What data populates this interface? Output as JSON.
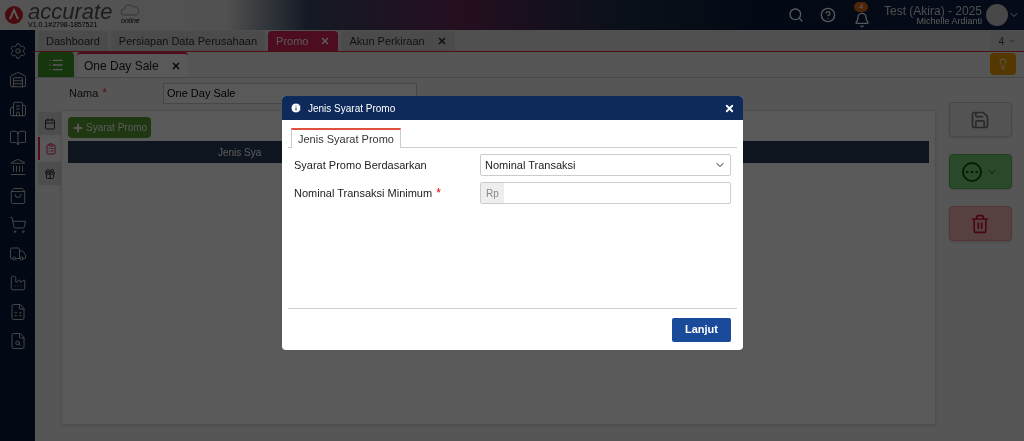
{
  "header": {
    "logo_text": "accurate",
    "logo_sub": "online",
    "version": "V1.0.1#2798-1857521",
    "notification_count": "4",
    "company": "Test (Akira) - 2025",
    "user": "Michelle Ardianti"
  },
  "tabs": [
    {
      "label": "Dashboard",
      "selected": false,
      "closable": false
    },
    {
      "label": "Persiapan Data Perusahaan",
      "selected": false,
      "closable": false
    },
    {
      "label": "Promo",
      "selected": true,
      "closable": true
    },
    {
      "label": "Akun Perkiraan",
      "selected": false,
      "closable": true
    }
  ],
  "tab_overflow": "4",
  "subtabs": [
    {
      "label": "One Day Sale",
      "selected": true
    }
  ],
  "form": {
    "label": "Nama",
    "required_mark": "*",
    "value": "One Day Sale"
  },
  "side_tabs": [
    {
      "selected": false
    },
    {
      "selected": true
    },
    {
      "selected": false
    }
  ],
  "add_button": "Syarat Promo",
  "table": {
    "columns": [
      "Jenis Sya"
    ]
  },
  "modal": {
    "title": "Jenis Syarat Promo",
    "tab": "Jenis Syarat Promo",
    "fields": [
      {
        "label": "Syarat Promo Berdasarkan",
        "kind": "select",
        "value": "Nominal Transaksi"
      },
      {
        "label": "Nominal Transaksi Minimum",
        "required_mark": "*",
        "kind": "currency",
        "prefix": "Rp"
      }
    ],
    "button": "Lanjut"
  }
}
